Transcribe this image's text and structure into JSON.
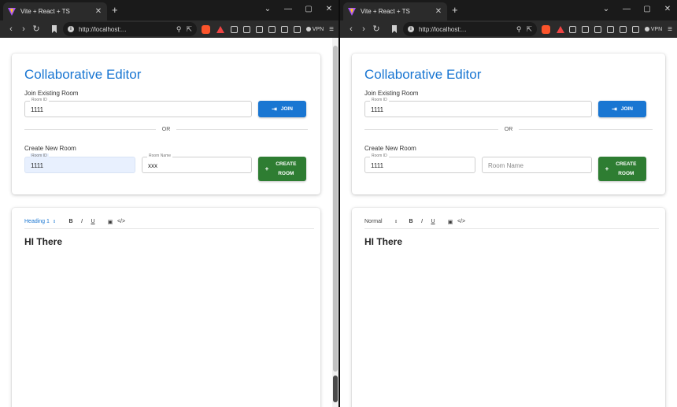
{
  "browser": {
    "tab_title": "Vite + React + TS",
    "tab_close": "✕",
    "new_tab": "+",
    "url": "http://localhost:...",
    "vpn_label": "VPN",
    "controls": {
      "dropdown": "⌄",
      "minimize": "—",
      "maximize": "▢",
      "close": "✕"
    },
    "nav": {
      "back": "‹",
      "forward": "›",
      "reload": "↻",
      "menu": "≡"
    }
  },
  "app": {
    "title": "Collaborative Editor",
    "join_label": "Join Existing Room",
    "room_id_legend": "Room ID",
    "join_button": "JOIN",
    "or_text": "OR",
    "create_label": "Create New Room",
    "room_name_legend": "Room Name",
    "room_name_placeholder": "Room Name",
    "create_button": "CREATE ROOM"
  },
  "left": {
    "join_room_id": "1111",
    "create_room_id": "1111",
    "create_room_name": "xxx",
    "heading_select": "Heading 1",
    "editor_text": "HI There"
  },
  "right": {
    "join_room_id": "1111",
    "create_room_id": "1111",
    "heading_select": "Normal",
    "editor_text": "HI There"
  },
  "toolbar": {
    "caret": "⇕",
    "bold": "B",
    "italic": "I",
    "underline": "U",
    "image": "▣",
    "code": "</>"
  },
  "icons": {
    "join_icon": "⇥",
    "create_icon": "+"
  },
  "colors": {
    "primary": "#1976d2",
    "success": "#2e7d32",
    "autofill": "#e8f0fe"
  }
}
